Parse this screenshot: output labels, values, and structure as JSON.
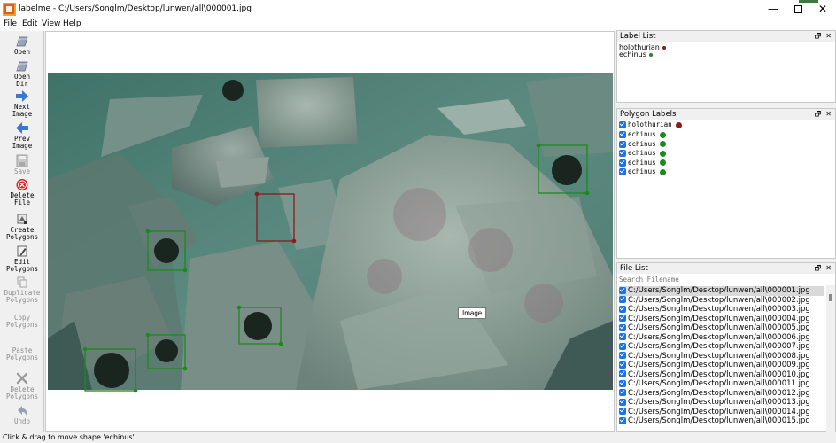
{
  "window": {
    "title": "labelme - C:/Users/Songlm/Desktop/lunwen/all\\000001.jpg",
    "min": "—",
    "close": "✕"
  },
  "menu": [
    {
      "key": "F",
      "rest": "ile"
    },
    {
      "key": "E",
      "rest": "dit"
    },
    {
      "key": "V",
      "rest": "iew"
    },
    {
      "key": "H",
      "rest": "elp"
    }
  ],
  "toolbar": {
    "open": [
      "Open"
    ],
    "open_dir": [
      "Open",
      "Dir"
    ],
    "next_image": [
      "Next",
      "Image"
    ],
    "prev_image": [
      "Prev",
      "Image"
    ],
    "save": [
      "Save"
    ],
    "delete_file": [
      "Delete",
      "File"
    ],
    "create_polygons": [
      "Create",
      "Polygons"
    ],
    "edit_polygons": [
      "Edit",
      "Polygons"
    ],
    "duplicate_polygons": [
      "Duplicate",
      "Polygons"
    ],
    "copy_polygons": [
      "Copy",
      "Polygons"
    ],
    "paste_polygons": [
      "Paste",
      "Polygons"
    ],
    "delete_polygons": [
      "Delete",
      "Polygons"
    ],
    "undo": [
      "Undo"
    ]
  },
  "tooltip": "Image",
  "label_list": {
    "title": "Label List",
    "items": [
      {
        "name": "holothurian",
        "color": "#8b1a1a"
      },
      {
        "name": "echinus",
        "color": "#1a8b1a"
      }
    ]
  },
  "polygon_labels": {
    "title": "Polygon Labels",
    "items": [
      {
        "name": "holothurian",
        "color": "#8b1a1a"
      },
      {
        "name": "echinus",
        "color": "#1a8b1a"
      },
      {
        "name": "echinus",
        "color": "#1a8b1a"
      },
      {
        "name": "echinus",
        "color": "#1a8b1a"
      },
      {
        "name": "echinus",
        "color": "#1a8b1a"
      },
      {
        "name": "echinus",
        "color": "#1a8b1a"
      }
    ]
  },
  "file_list": {
    "title": "File List",
    "search_placeholder": "Search Filename",
    "files": [
      "C:/Users/Songlm/Desktop/lunwen/all\\000001.jpg",
      "C:/Users/Songlm/Desktop/lunwen/all\\000002.jpg",
      "C:/Users/Songlm/Desktop/lunwen/all\\000003.jpg",
      "C:/Users/Songlm/Desktop/lunwen/all\\000004.jpg",
      "C:/Users/Songlm/Desktop/lunwen/all\\000005.jpg",
      "C:/Users/Songlm/Desktop/lunwen/all\\000006.jpg",
      "C:/Users/Songlm/Desktop/lunwen/all\\000007.jpg",
      "C:/Users/Songlm/Desktop/lunwen/all\\000008.jpg",
      "C:/Users/Songlm/Desktop/lunwen/all\\000009.jpg",
      "C:/Users/Songlm/Desktop/lunwen/all\\000010.jpg",
      "C:/Users/Songlm/Desktop/lunwen/all\\000011.jpg",
      "C:/Users/Songlm/Desktop/lunwen/all\\000012.jpg",
      "C:/Users/Songlm/Desktop/lunwen/all\\000013.jpg",
      "C:/Users/Songlm/Desktop/lunwen/all\\000014.jpg",
      "C:/Users/Songlm/Desktop/lunwen/all\\000015.jpg"
    ]
  },
  "status": "Click & drag to move shape 'echinus'",
  "colors": {
    "holothurian": "#8b1a1a",
    "echinus": "#1a8b1a",
    "checkbox": "#1a73e8"
  }
}
